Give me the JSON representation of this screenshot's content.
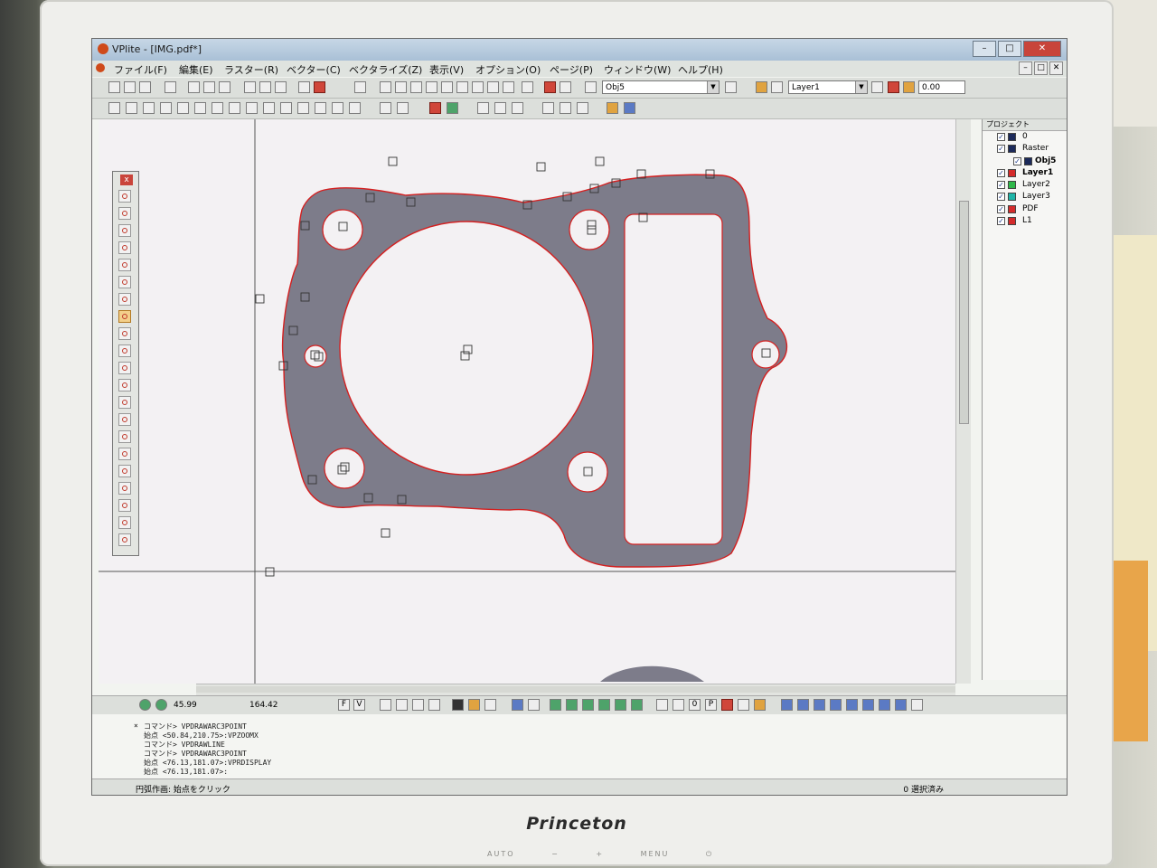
{
  "window": {
    "title": "VPlite - [IMG.pdf*]",
    "controls": [
      "–",
      "□",
      "✕"
    ],
    "mdi_controls": [
      "–",
      "□",
      "✕"
    ]
  },
  "menu": [
    "ファイル(F)",
    "編集(E)",
    "ラスター(R)",
    "ベクター(C)",
    "ベクタライズ(Z)",
    "表示(V)",
    "オプション(O)",
    "ページ(P)",
    "ウィンドウ(W)",
    "ヘルプ(H)"
  ],
  "toolbar": {
    "object_combo": "Obj5",
    "layer_combo": "Layer1",
    "line_width": "0.00"
  },
  "project_panel": {
    "header": "プロジェクト",
    "items": [
      {
        "label": "0",
        "checked": true,
        "swatch": "#1c2a5a",
        "bold": false
      },
      {
        "label": "Raster",
        "checked": true,
        "swatch": "#1c2a5a",
        "bold": false
      },
      {
        "label": "Obj5",
        "checked": true,
        "swatch": "#1c2a5a",
        "bold": true
      },
      {
        "label": "Layer1",
        "checked": true,
        "swatch": "#d42b2b",
        "bold": true
      },
      {
        "label": "Layer2",
        "checked": true,
        "swatch": "#2fb84a",
        "bold": false
      },
      {
        "label": "Layer3",
        "checked": true,
        "swatch": "#1fb5a8",
        "bold": false
      },
      {
        "label": "PDF",
        "checked": true,
        "swatch": "#d42b2b",
        "bold": false
      },
      {
        "label": "L1",
        "checked": true,
        "swatch": "#d42b2b",
        "bold": false
      }
    ]
  },
  "status": {
    "coord_x": "45.99",
    "coord_y": "164.42",
    "snap_f": "F",
    "snap_v": "V",
    "grid_labels": [
      "0",
      "P"
    ]
  },
  "command_history": [
    "コマンド> VPDRAWARC3POINT",
    "始点 <50.84,210.75>:VPZOOMX",
    "コマンド> VPDRAWLINE",
    "コマンド> VPDRAWARC3POINT",
    "始点 <76.13,181.07>:VPRDISPLAY",
    "始点 <76.13,181.07>:"
  ],
  "prompt": "円弧作画: 始点をクリック",
  "selection_count": "0 選択済み",
  "monitor": {
    "brand": "Princeton",
    "buttons": [
      "AUTO",
      "−",
      "+",
      "MENU",
      "⏻"
    ]
  },
  "colors": {
    "gasket": "#7d7c8a",
    "outline": "#d42020",
    "canvas": "#f3f1f3"
  }
}
